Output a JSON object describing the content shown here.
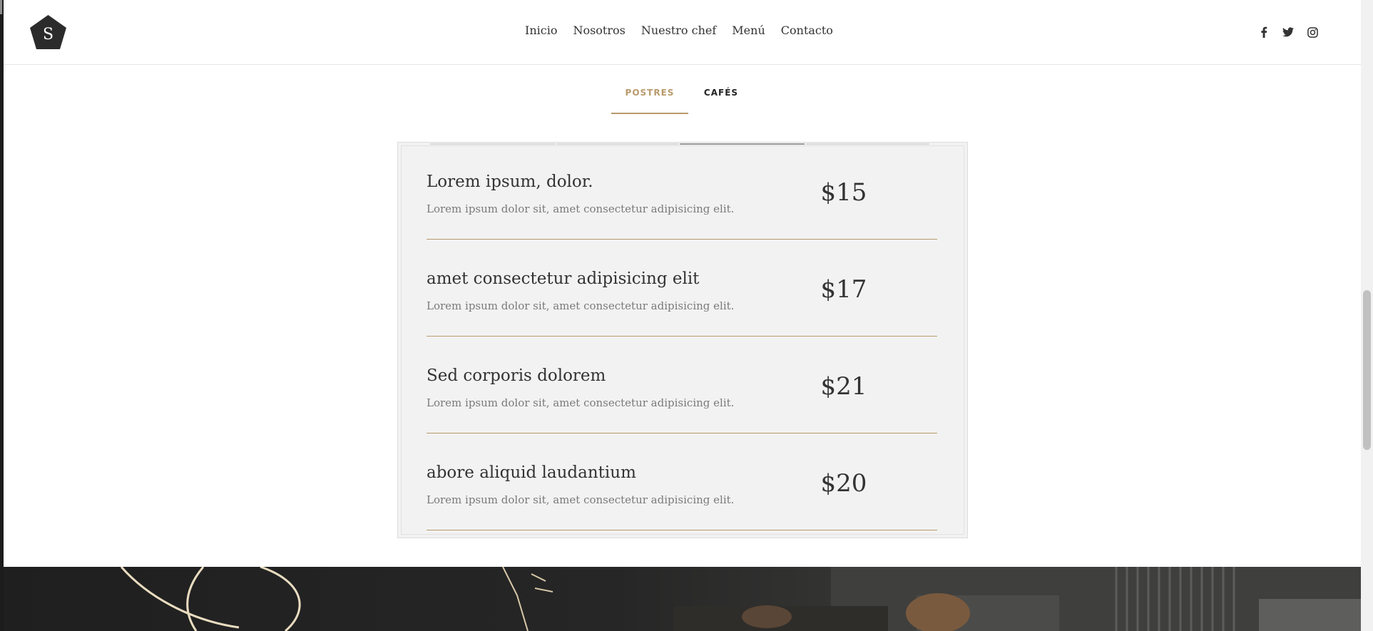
{
  "nav": {
    "logo_letter": "S",
    "links": [
      {
        "label": "Inicio"
      },
      {
        "label": "Nosotros"
      },
      {
        "label": "Nuestro chef"
      },
      {
        "label": "Menú"
      },
      {
        "label": "Contacto"
      }
    ],
    "social": [
      {
        "icon": "facebook-icon"
      },
      {
        "icon": "twitter-icon"
      },
      {
        "icon": "instagram-icon"
      }
    ]
  },
  "tabs": [
    {
      "label": "POSTRES",
      "active": true
    },
    {
      "label": "CAFÉS",
      "active": false
    }
  ],
  "menu_items": [
    {
      "name": "Lorem ipsum, dolor.",
      "description": "Lorem ipsum dolor sit, amet consectetur adipisicing elit.",
      "price": "$15"
    },
    {
      "name": "amet consectetur adipisicing elit",
      "description": "Lorem ipsum dolor sit, amet consectetur adipisicing elit.",
      "price": "$17"
    },
    {
      "name": "Sed corporis dolorem",
      "description": "Lorem ipsum dolor sit, amet consectetur adipisicing elit.",
      "price": "$21"
    },
    {
      "name": "abore aliquid laudantium",
      "description": "Lorem ipsum dolor sit, amet consectetur adipisicing elit.",
      "price": "$20"
    }
  ],
  "colors": {
    "accent": "#b99a6b",
    "text": "#333333",
    "muted": "#7a7a7a",
    "panel": "#f2f2f2",
    "logo_bg": "#2b2b2b"
  }
}
